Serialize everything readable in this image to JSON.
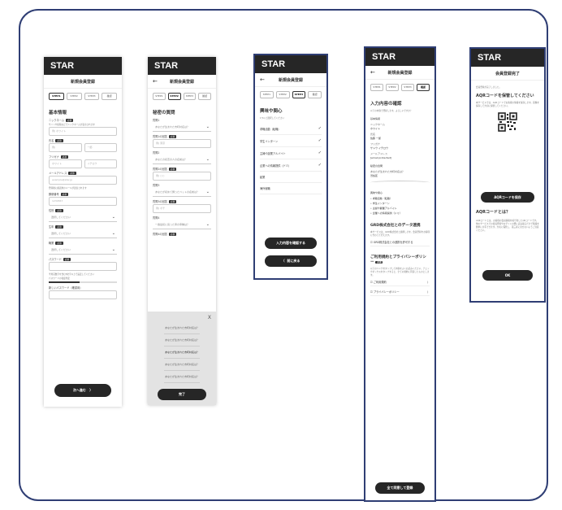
{
  "app_name": "STAR",
  "screen1": {
    "title": "新規会員登録",
    "steps": [
      "STEP1",
      "STEP2",
      "STEP3",
      "確認"
    ],
    "section": "基本情報",
    "req": "必須",
    "nickname_label": "ニックネーム",
    "nickname_note": "サイトや投稿などでニックネームが表示されます",
    "nickname_ph": "例) ホワイト",
    "name_label": "氏名",
    "last_ph": "例)",
    "first_ph": "一郎",
    "kana_label": "フリガナ",
    "kana_last_ph": "ホワイト",
    "kana_first_ph": "イチロウ",
    "email_label": "メールアドレス",
    "email_ph": "example@star.jp",
    "email_note": "登録後に確認用のメールが送信されます",
    "zip_label": "郵便番号",
    "zip_ph": "1234567",
    "gender_label": "性別",
    "gender_ph": "選択してください",
    "birth_label": "生年",
    "birth_ph": "選択してください",
    "job_label": "職業",
    "job_ph": "選択してください",
    "pw_label": "パスワード",
    "pw_note": "半角英数字を含む8文字以上で設定してください",
    "pw_strength_label": "パスワードの強度判定",
    "pw_strength": 0.45,
    "pw2_label": "新しいパスワード（確認用）",
    "next": "次へ進む"
  },
  "screen2": {
    "title": "新規会員登録",
    "steps": [
      "STEP1",
      "STEP2",
      "STEP3",
      "確認"
    ],
    "section": "秘密の質問",
    "q1_label": "質問1",
    "q1_ph": "あなたが生まれた市町村名は？",
    "a1_label": "質問1の回答",
    "a1_ph": "例) 東京",
    "q2_label": "質問2",
    "q2_ph": "あなたの初恋の人の名前は？",
    "a2_label": "質問2の回答",
    "a2_ph": "例) ○○",
    "q3_label": "質問3",
    "q3_ph": "あなたが初めて飼ったペットの名前は？",
    "a3_label": "質問3の回答",
    "a3_ph": "例) ポチ",
    "q4_label": "質問4",
    "q4_ph": "一番最初に買った車の車種は？",
    "a4_label": "質問4の回答",
    "close": "X",
    "sheet_options": [
      "あなたが生まれた市町村名は？",
      "あなたが生まれた市町村名は？",
      "あなたが生まれた市町村名は？",
      "あなたが生まれた市町村名は？",
      "あなたが生まれた市町村名は？"
    ],
    "done": "完了"
  },
  "screen3": {
    "title": "新規会員登録",
    "steps": [
      "STEP1",
      "STEP2",
      "STEP3",
      "確認"
    ],
    "section": "興味や関心",
    "note": "1つ以上選択してください",
    "items": [
      {
        "label": "求職活動（転職）",
        "checked": true
      },
      {
        "label": "学生インターン",
        "checked": true
      },
      {
        "label": "主婦や副業アルバイト",
        "checked": true
      },
      {
        "label": "企業への情報提供（ドミ）",
        "checked": true
      },
      {
        "label": "起業",
        "checked": false
      },
      {
        "label": "海外就職",
        "checked": false
      }
    ],
    "check_glyph": "✓",
    "confirm": "入力内容を確認する",
    "back": "前に戻る"
  },
  "screen4": {
    "title": "新規会員登録",
    "steps": [
      "STEP1",
      "STEP2",
      "STEP3",
      "確認"
    ],
    "section": "入力内容の確認",
    "note": "以下の内容で登録します。よろしいですか？",
    "basic": "基本情報",
    "nickname_k": "ニックネーム",
    "nickname_v": "ホワイト",
    "name_k": "氏名",
    "name_v": "佐藤 一郎",
    "kana_k": "フリガナ",
    "kana_v": "サトウ イチロウ",
    "email_k": "メールアドレス",
    "email_v": "[email protected]",
    "secret": "秘密の質問",
    "secret_q": "あなたが生まれた市町村名は？",
    "secret_a": "渋谷区",
    "interest": "興味や関心",
    "interests": [
      "求職活動（転職）",
      "学生インターン",
      "主婦や副業アルバイト",
      "企業への情報提供（ドミ）"
    ],
    "data_title": "GRD株式会社とのデータ連携",
    "data_note": "本サービスは、GRD株式会社と連携します。会員登録をお客様に代わって行えます。",
    "data_check": "GRD株式会社との連携を許可する",
    "terms_title": "ご利用規約とプライバシーポリシー",
    "req": "必須",
    "terms_note": "以下のリンクをタップして内容をよくお読みください。チェックボックスをタップすると、全ての規約に同意したものとします。",
    "terms_link": "ご利用規約",
    "privacy_link": "プライバシーポリシー",
    "agree": "全て同意して登録"
  },
  "screen5": {
    "title": "会員登録完了",
    "done_note": "会員登録が完了しました。",
    "qr_title": "AQRコードを保管してください",
    "qr_desc": "本サービスでは、AQRコードでお客様の情報を保存します。画像を保存して大切に保管してください。",
    "save": "AQRコードを保存",
    "about": "AQRコードとは？",
    "about_desc": "AQRコードとは、お客様の会員情報を暗号化したQRコードです。他のサービスでの会員登録やログインの際に読み取るだけで情報を簡単に共有できます。大切に保管し、第三者に見せないようご注意ください。",
    "ok": "OK"
  }
}
